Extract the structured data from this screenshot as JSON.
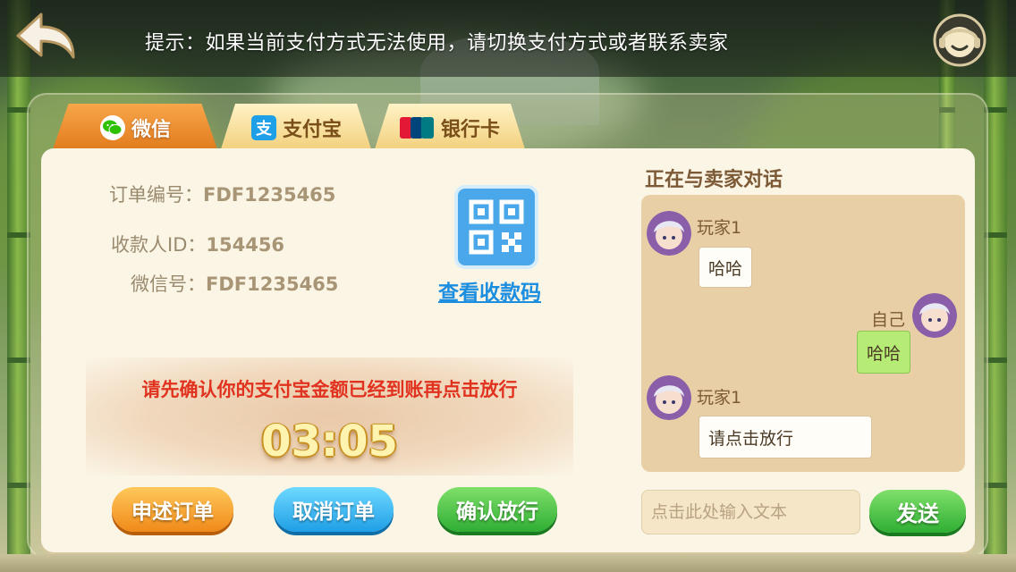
{
  "topbar": {
    "hint": "提示：如果当前支付方式无法使用，请切换支付方式或者联系卖家",
    "back_icon": "back-arrow-icon",
    "service_icon": "customer-service-icon"
  },
  "tabs": [
    {
      "label": "微信",
      "icon": "wechat-icon",
      "active": true
    },
    {
      "label": "支付宝",
      "icon": "alipay-icon",
      "active": false
    },
    {
      "label": "银行卡",
      "icon": "unionpay-icon",
      "active": false
    }
  ],
  "order": {
    "order_no_label": "订单编号：",
    "order_no": "FDF1235465",
    "payee_label": "收款人ID：",
    "payee_id": "154456",
    "wechat_label": "微信号：",
    "wechat_id": "FDF1235465"
  },
  "qr": {
    "icon": "qr-code-icon",
    "link_label": "查看收款码"
  },
  "confirm": {
    "notice": "请先确认你的支付宝金额已经到账再点击放行",
    "timer": "03:05"
  },
  "actions": {
    "appeal": "申述订单",
    "cancel": "取消订单",
    "release": "确认放行"
  },
  "chat": {
    "title": "正在与卖家对话",
    "messages": [
      {
        "sender": "玩家1",
        "text": "哈哈",
        "self": false
      },
      {
        "sender": "自己",
        "text": "哈哈",
        "self": true
      },
      {
        "sender": "玩家1",
        "text": "请点击放行",
        "self": false
      }
    ],
    "input_placeholder": "点击此处输入文本",
    "send_label": "发送"
  },
  "colors": {
    "accent_orange": "#f08a1a",
    "accent_blue": "#1f9fe6",
    "accent_green": "#2fae33",
    "notice_red": "#e0321e",
    "link_blue": "#1c8ee0"
  }
}
